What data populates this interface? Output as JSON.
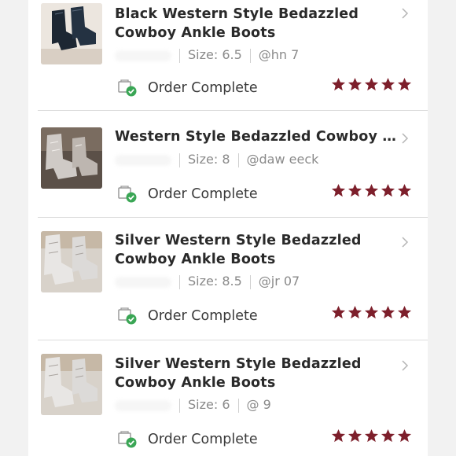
{
  "accent_color": "#7d1f2b",
  "success_color": "#3aa655",
  "orders": [
    {
      "title": "Black Western Style Bedazzled Cowboy Ankle Boots",
      "size": "Size: 6.5",
      "handle": "@hn   7",
      "status": "Order Complete",
      "rating": 5,
      "thumb_icon": "black-boot-photo"
    },
    {
      "title": "Western Style Bedazzled Cowboy An...",
      "size": "Size: 8",
      "handle": "@daw   eeck",
      "status": "Order Complete",
      "rating": 5,
      "thumb_icon": "silver-boot-photo"
    },
    {
      "title": "Silver Western Style Bedazzled Cowboy Ankle Boots",
      "size": "Size: 8.5",
      "handle": "@jr   07",
      "status": "Order Complete",
      "rating": 5,
      "thumb_icon": "silver-boot-photo"
    },
    {
      "title": "Silver Western Style Bedazzled Cowboy Ankle Boots",
      "size": "Size: 6",
      "handle": "@   9",
      "status": "Order Complete",
      "rating": 5,
      "thumb_icon": "silver-boot-photo"
    }
  ]
}
